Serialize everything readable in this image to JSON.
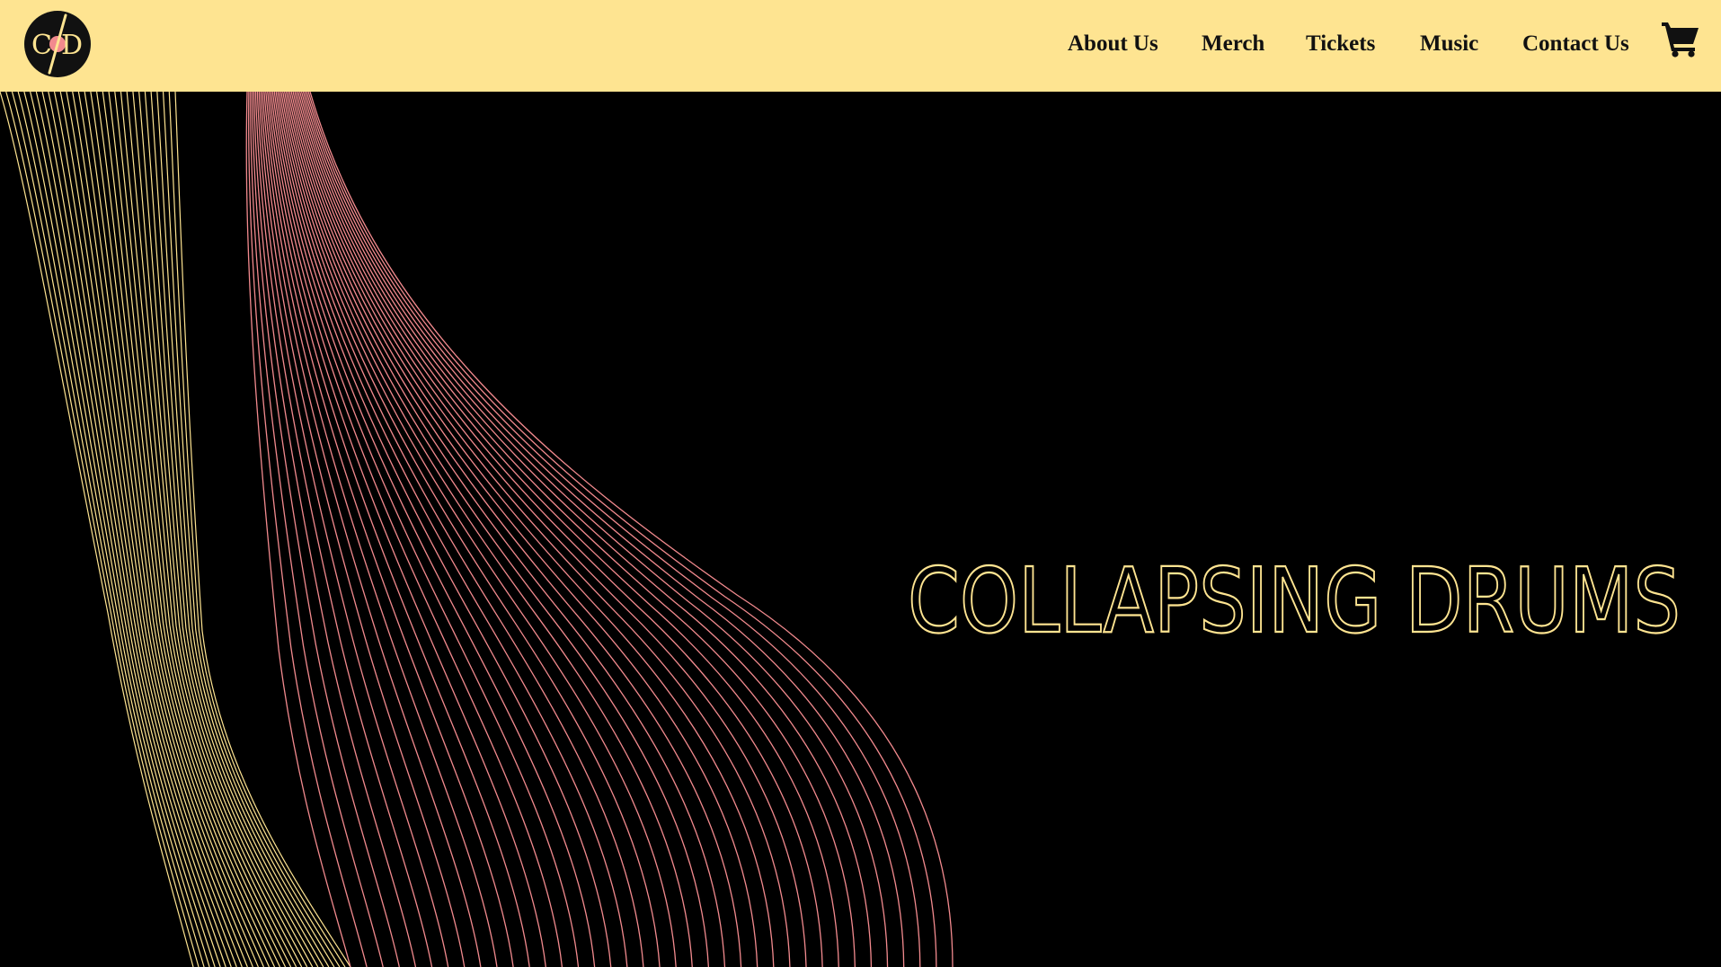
{
  "brand": {
    "logo_icon": "vinyl-record-logo-icon",
    "logo_text": "C/D"
  },
  "nav": {
    "items": [
      {
        "label": "About Us"
      },
      {
        "label": "Merch"
      },
      {
        "label": "Tickets"
      },
      {
        "label": "Music"
      },
      {
        "label": "Contact Us"
      }
    ],
    "cart_icon": "shopping-cart-icon"
  },
  "hero": {
    "title": "COLLAPSING DRUMS"
  },
  "colors": {
    "nav_background": "#FEE491",
    "hero_background": "#000000",
    "wave_yellow": "#FEE491",
    "wave_pink": "#F28A8E",
    "title_color": "#FEE491",
    "logo_accent": "#F28A8E"
  }
}
